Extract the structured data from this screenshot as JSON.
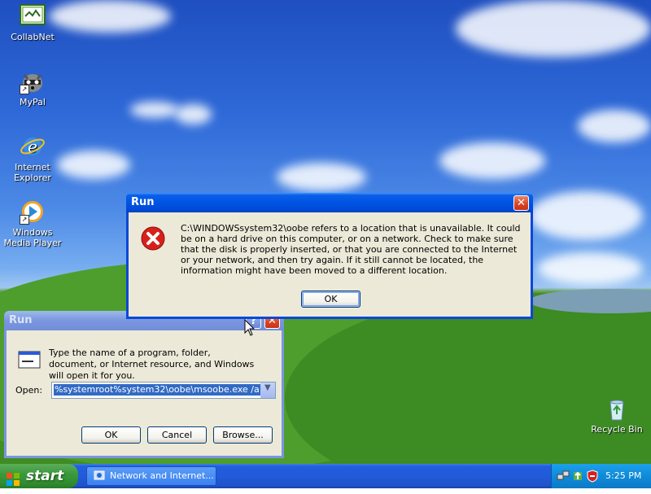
{
  "desktop": {
    "icons": [
      {
        "label": "CollabNet"
      },
      {
        "label": "MyPal"
      },
      {
        "label": "Internet Explorer"
      },
      {
        "label": "Windows Media Player"
      },
      {
        "label": "Recycle Bin"
      }
    ]
  },
  "error_dialog": {
    "title": "Run",
    "message": "C:\\WINDOWSsystem32\\oobe refers to a location that is unavailable. It could be on a hard drive on this computer, or on a network. Check to make sure that the disk is properly inserted, or that you are connected to the Internet or your network, and then try again. If it still cannot be located, the information might have been moved to a different location.",
    "ok_label": "OK",
    "icon": "error-icon"
  },
  "run_dialog": {
    "title": "Run",
    "description": "Type the name of a program, folder, document, or Internet resource, and Windows will open it for you.",
    "open_label": "Open:",
    "open_value": "%systemroot%system32\\oobe\\msoobe.exe /a",
    "ok_label": "OK",
    "cancel_label": "Cancel",
    "browse_label": "Browse..."
  },
  "taskbar": {
    "start_label": "start",
    "task_label": "Network and Internet...",
    "clock": "5:25 PM"
  },
  "colors": {
    "title_active": "#0054e3",
    "title_inactive": "#7a96df",
    "start_green": "#3c9a3c",
    "dialog_bg": "#ece9d8"
  }
}
